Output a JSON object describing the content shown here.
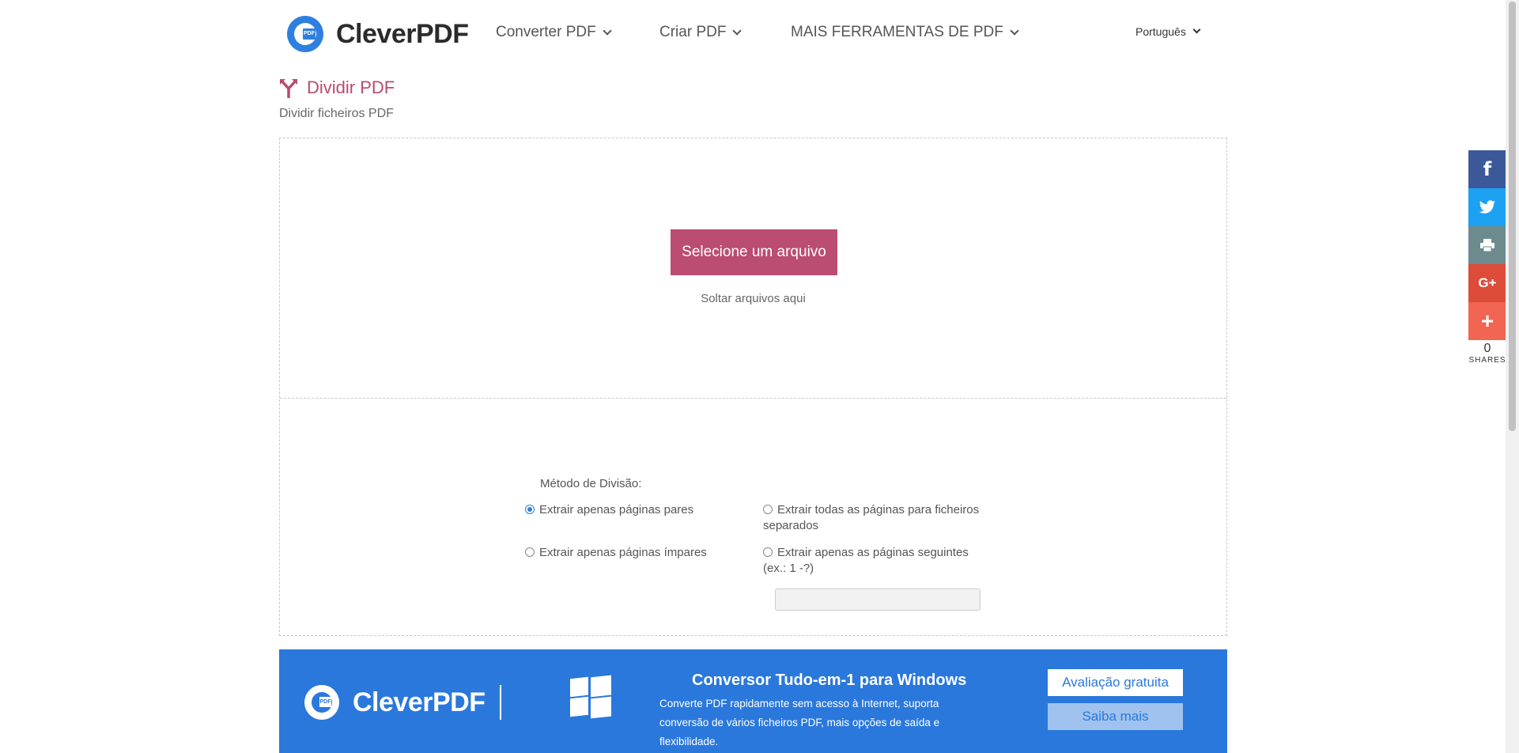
{
  "header": {
    "logo_text": "CleverPDF",
    "logo_badge": "PDF",
    "nav": [
      {
        "label": "Converter PDF"
      },
      {
        "label": "Criar PDF"
      },
      {
        "label": "MAIS FERRAMENTAS DE PDF"
      }
    ],
    "language": "Português"
  },
  "page": {
    "title": "Dividir PDF",
    "subtitle": "Dividir ficheiros PDF",
    "title_color": "#b94a6e"
  },
  "upload": {
    "select_button": "Selecione um arquivo",
    "drop_text": "Soltar arquivos aqui",
    "button_color": "#bb4c72"
  },
  "split": {
    "method_label": "Método de Divisão:",
    "options": [
      {
        "label": "Extrair apenas páginas pares",
        "selected": true
      },
      {
        "label": "Extrair todas as páginas para ficheiros separados",
        "selected": false
      },
      {
        "label": "Extrair apenas páginas ímpares",
        "selected": false
      },
      {
        "label": "Extrair apenas as páginas seguintes (ex.: 1 -?)",
        "selected": false
      }
    ],
    "pages_input_value": ""
  },
  "banner": {
    "logo_text": "CleverPDF",
    "title": "Conversor Tudo-em-1 para Windows",
    "description": "Converte PDF rapidamente sem acesso à Internet, suporta conversão de vários ficheiros PDF, mais opções de saída e flexibilidade.",
    "trial_button": "Avaliação gratuita",
    "more_button": "Saiba mais",
    "color": "#2a78dc"
  },
  "share": {
    "buttons": [
      {
        "icon": "facebook-icon",
        "glyph": "f",
        "color": "#3b5998"
      },
      {
        "icon": "twitter-icon",
        "glyph": "🐦",
        "color": "#1da1f2"
      },
      {
        "icon": "print-icon",
        "glyph": "🖶",
        "color": "#6d8b8f"
      },
      {
        "icon": "google-plus-icon",
        "glyph": "G+",
        "color": "#dd4b39"
      },
      {
        "icon": "plus-icon",
        "glyph": "+",
        "color": "#f26552"
      }
    ],
    "count": "0",
    "label": "SHARES"
  }
}
